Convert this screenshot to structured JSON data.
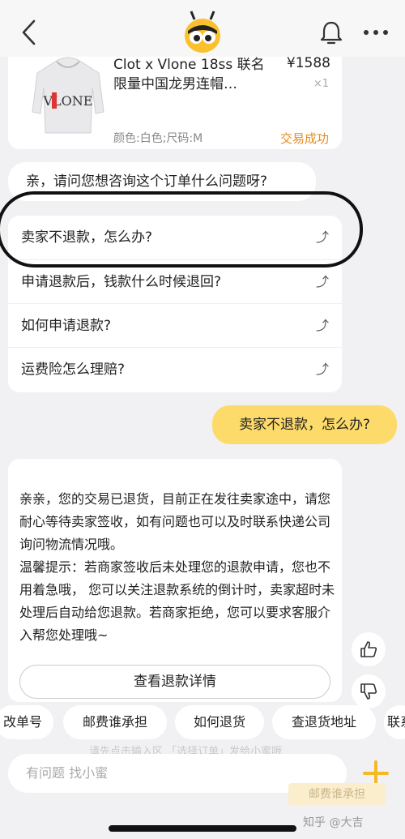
{
  "nav": {
    "back_icon": "chevron-left-icon",
    "mascot_icon": "bee-mascot-icon",
    "notification_icon": "bell-icon",
    "more_icon": "more-dots-icon"
  },
  "product": {
    "title": "Clot x Vlone 18ss 联名限量中国龙男连帽…",
    "price": "¥1588",
    "quantity": "×1",
    "spec": "颜色:白色;尺码:M",
    "status": "交易成功",
    "image_text": "VLONE"
  },
  "greeting": "亲，请问您想咨询这个订单什么问题呀?",
  "faq": [
    {
      "label": "卖家不退款，怎么办?"
    },
    {
      "label": "申请退款后，钱款什么时候退回?"
    },
    {
      "label": "如何申请退款?"
    },
    {
      "label": "运费险怎么理赔?"
    }
  ],
  "user_message": "卖家不退款，怎么办?",
  "reply": {
    "p1": "亲亲，您的交易已退货，目前正在发往卖家途中，请您耐心等待卖家签收，如有问题也可以及时联系快递公司询问物流情况哦。",
    "p2": "温馨提示：若商家签收后未处理您的退款申请，您也不用着急哦， 您可以关注退款系统的倒计时，卖家超时未处理后自动给您退款。若商家拒绝，您可以要求客服介入帮您处理哦~",
    "button": "查看退款详情"
  },
  "quick_chips": [
    "改单号",
    "邮费谁承担",
    "如何退货",
    "查退货地址",
    "联系"
  ],
  "hint": "请先点击输入区 「选择订单」发给小蜜哦",
  "input_placeholder": "有问题 找小蜜",
  "ghost_chip": "邮费谁承担",
  "watermark": "知乎 @大吉",
  "colors": {
    "accent_yellow": "#fddb6a",
    "status_orange": "#e98b1e",
    "plus_yellow": "#f5b925",
    "background": "#f1f1f3"
  }
}
